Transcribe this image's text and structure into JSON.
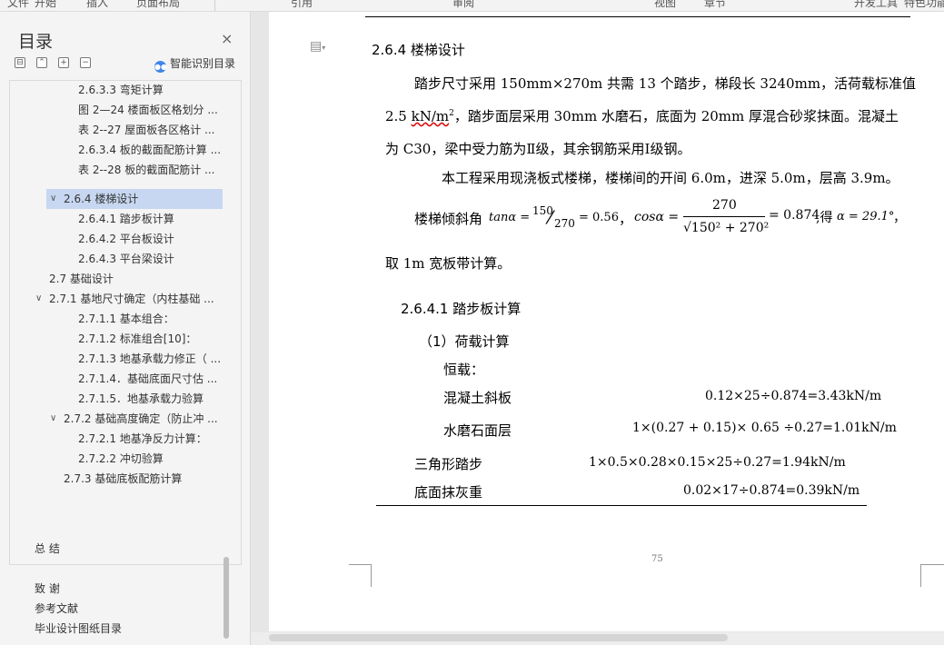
{
  "toolbar": {
    "items": [
      "文件",
      "开始",
      "插入",
      "页面布局",
      "引用",
      "审阅",
      "视图",
      "章节",
      "开发工具",
      "特色功能"
    ]
  },
  "sidebar": {
    "title": "目录",
    "close": "×",
    "controls": [
      "⊟",
      "⌃",
      "+",
      "−"
    ],
    "ai_toc": "智能识别目录",
    "toc": [
      {
        "label": "2.6.3.3 弯矩计算",
        "level": 4
      },
      {
        "label": "图 2—24 楼面板区格划分 ...",
        "level": 4
      },
      {
        "label": "表 2--27 屋面板各区格计 ...",
        "level": 4
      },
      {
        "label": "2.6.3.4 板的截面配筋计算 ...",
        "level": 4
      },
      {
        "label": "表 2--28 板的截面配筋计 ...",
        "level": 4
      },
      {
        "label": "2.6.4 楼梯设计",
        "level": 3,
        "expanded": true,
        "selected": true
      },
      {
        "label": "2.6.4.1 踏步板计算",
        "level": 4
      },
      {
        "label": "2.6.4.2 平台板设计",
        "level": 4
      },
      {
        "label": "2.6.4.3 平台梁设计",
        "level": 4
      },
      {
        "label": "2.7  基础设计",
        "level": 2
      },
      {
        "label": "2.7.1 基地尺寸确定（内柱基础 ...",
        "level": 2,
        "expanded": true
      },
      {
        "label": "2.7.1.1 基本组合：",
        "level": 4
      },
      {
        "label": "2.7.1.2 标准组合[10]：",
        "level": 4
      },
      {
        "label": "2.7.1.3 地基承载力修正（ ...",
        "level": 4
      },
      {
        "label": "2.7.1.4．基础底面尺寸估 ...",
        "level": 4
      },
      {
        "label": "2.7.1.5．地基承载力验算",
        "level": 4
      },
      {
        "label": "2.7.2 基础高度确定（防止冲 ...",
        "level": 3,
        "expanded": true
      },
      {
        "label": "2.7.2.1 地基净反力计算：",
        "level": 4
      },
      {
        "label": "2.7.2.2 冲切验算",
        "level": 4
      },
      {
        "label": "2.7.3 基础底板配筋计算",
        "level": 3
      }
    ],
    "bottom_items": [
      "总  结",
      "致  谢",
      "参考文献",
      "毕业设计图纸目录"
    ]
  },
  "document": {
    "section_heading": "2.6.4 楼梯设计",
    "p1_line1": "踏步尺寸采用 150mm×270m 共需 13 个踏步，梯段长 3240mm，活荷载标准值",
    "p1_line2a": "2.5 ",
    "p1_line2_unit": "kN/m",
    "p1_line2_sup": "2",
    "p1_line2b": "，踏步面层采用 30mm 水磨石，底面为 20mm 厚混合砂浆抹面。混凝土",
    "p1_line3": "为 C30，梁中受力筋为Ⅱ级，其余钢筋采用Ⅰ级钢。",
    "p2": "本工程采用现浇板式楼梯，楼梯间的开间 6.0m，进深 5.0m，层高 3.9m。",
    "formula": {
      "prefix": "楼梯倾斜角",
      "tan": "tanα =",
      "num": "150",
      "slash": "⁄",
      "den": "270",
      "tan_result": "= 0.56",
      "comma1": "，",
      "cos": "cosα =",
      "cos_num": "270",
      "cos_den": "√150² + 270²",
      "cos_result": "= 0.874",
      "get": ",得",
      "alpha": "α = 29.1°",
      "comma2": "，"
    },
    "p3": "取 1m 宽板带计算。",
    "sub_heading": "2.6.4.1 踏步板计算",
    "load_heading": "（1）荷载计算",
    "dead_load": "恒载：",
    "rows": [
      {
        "label": "混凝土斜板",
        "formula": "0.12×25÷0.874=3.43kN/m"
      },
      {
        "label": "水磨石面层",
        "formula": "1×(0.27 + 0.15)× 0.65 ÷0.27=1.01kN/m"
      },
      {
        "label": "三角形踏步",
        "formula": "1×0.5×0.28×0.15×25÷0.27=1.94kN/m"
      },
      {
        "label": "底面抹灰重",
        "formula": "0.02×17÷0.874=0.39kN/m"
      }
    ],
    "page_number": "75"
  }
}
